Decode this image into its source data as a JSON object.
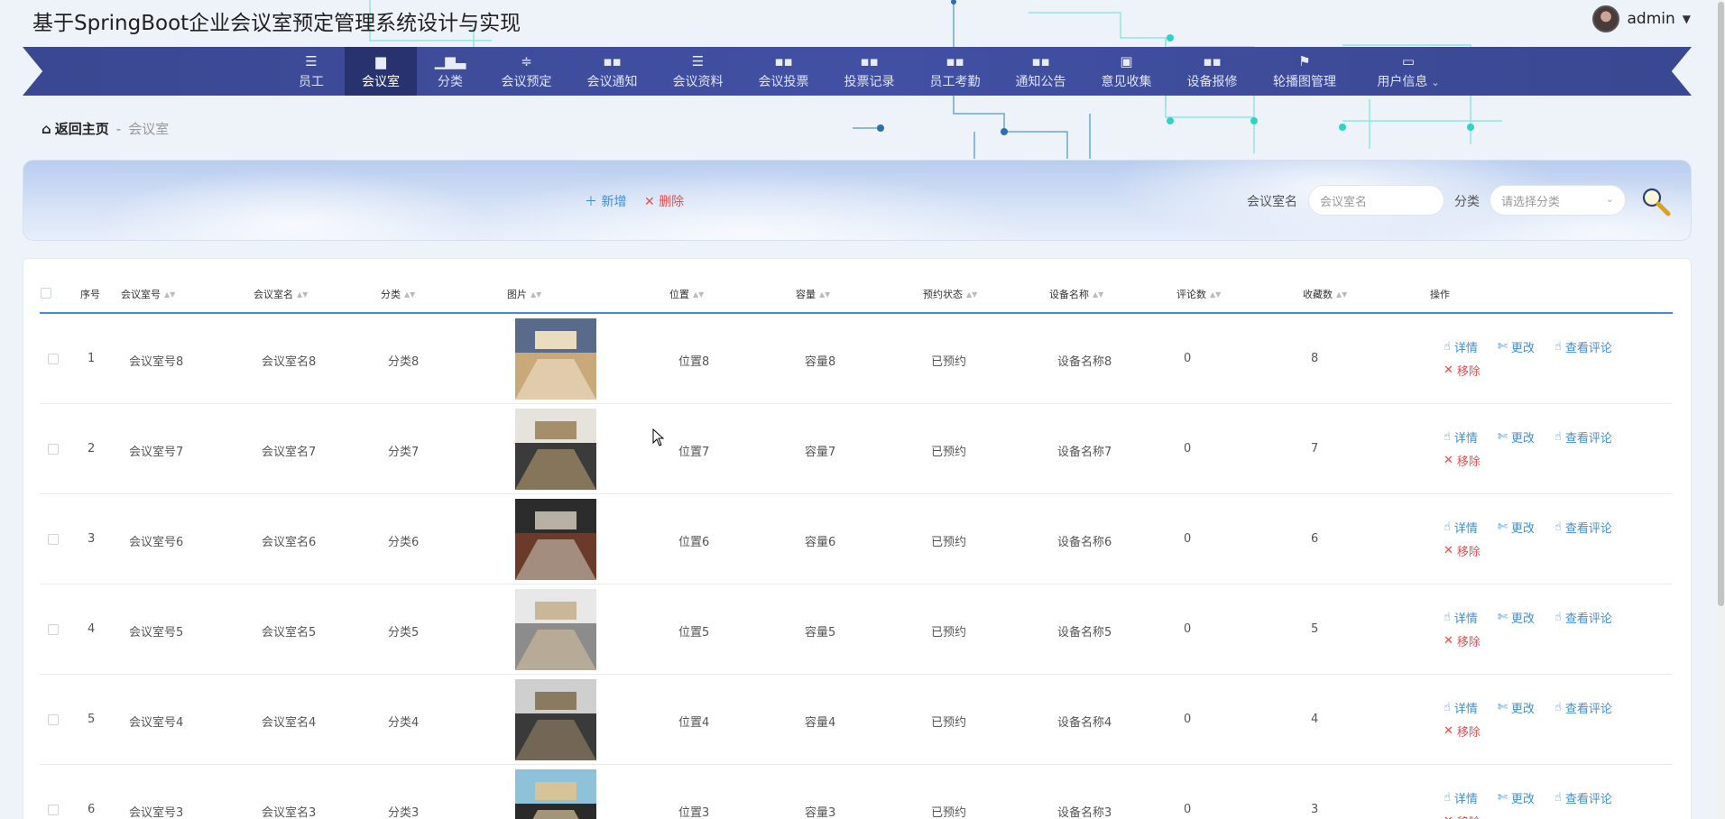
{
  "app": {
    "title": "基于SpringBoot企业会议室预定管理系统设计与实现",
    "user": "admin"
  },
  "nav": {
    "items": [
      {
        "label": "员工",
        "icon": "list-icon"
      },
      {
        "label": "会议室",
        "icon": "chair-icon"
      },
      {
        "label": "分类",
        "icon": "bar-chart-icon"
      },
      {
        "label": "会议预定",
        "icon": "sliders-icon"
      },
      {
        "label": "会议通知",
        "icon": "grid-icon"
      },
      {
        "label": "会议资料",
        "icon": "list-icon"
      },
      {
        "label": "会议投票",
        "icon": "grid-icon"
      },
      {
        "label": "投票记录",
        "icon": "grid-icon"
      },
      {
        "label": "员工考勤",
        "icon": "grid-icon"
      },
      {
        "label": "通知公告",
        "icon": "grid-icon"
      },
      {
        "label": "意见收集",
        "icon": "briefcase-icon"
      },
      {
        "label": "设备报修",
        "icon": "grid-icon"
      },
      {
        "label": "轮播图管理",
        "icon": "flag-icon"
      },
      {
        "label": "用户信息",
        "icon": "card-icon"
      }
    ],
    "active_index": 1
  },
  "breadcrumb": {
    "home": "返回主页",
    "separator": "-",
    "current": "会议室"
  },
  "toolbar": {
    "add_label": "新增",
    "delete_label": "删除",
    "name_label": "会议室名",
    "name_placeholder": "会议室名",
    "category_label": "分类",
    "category_placeholder": "请选择分类"
  },
  "table": {
    "headers": [
      "序号",
      "会议室号",
      "会议室名",
      "分类",
      "图片",
      "位置",
      "容量",
      "预约状态",
      "设备名称",
      "评论数",
      "收藏数",
      "操作"
    ],
    "actions": {
      "detail": "详情",
      "edit": "更改",
      "comments": "查看评论",
      "remove": "移除"
    },
    "rows": [
      {
        "index": "1",
        "room_no": "会议室号8",
        "room_name": "会议室名8",
        "category": "分类8",
        "location": "位置8",
        "capacity": "容量8",
        "status": "已预约",
        "device": "设备名称8",
        "comments": "0",
        "favorites": "8"
      },
      {
        "index": "2",
        "room_no": "会议室号7",
        "room_name": "会议室名7",
        "category": "分类7",
        "location": "位置7",
        "capacity": "容量7",
        "status": "已预约",
        "device": "设备名称7",
        "comments": "0",
        "favorites": "7"
      },
      {
        "index": "3",
        "room_no": "会议室号6",
        "room_name": "会议室名6",
        "category": "分类6",
        "location": "位置6",
        "capacity": "容量6",
        "status": "已预约",
        "device": "设备名称6",
        "comments": "0",
        "favorites": "6"
      },
      {
        "index": "4",
        "room_no": "会议室号5",
        "room_name": "会议室名5",
        "category": "分类5",
        "location": "位置5",
        "capacity": "容量5",
        "status": "已预约",
        "device": "设备名称5",
        "comments": "0",
        "favorites": "5"
      },
      {
        "index": "5",
        "room_no": "会议室号4",
        "room_name": "会议室名4",
        "category": "分类4",
        "location": "位置4",
        "capacity": "容量4",
        "status": "已预约",
        "device": "设备名称4",
        "comments": "0",
        "favorites": "4"
      },
      {
        "index": "6",
        "room_no": "会议室号3",
        "room_name": "会议室名3",
        "category": "分类3",
        "location": "位置3",
        "capacity": "容量3",
        "status": "已预约",
        "device": "设备名称3",
        "comments": "0",
        "favorites": "3"
      }
    ]
  },
  "colors": {
    "nav_bg": "#4150a3",
    "nav_active": "#27326f",
    "accent_blue": "#3d8fd9",
    "danger_red": "#e05151"
  }
}
